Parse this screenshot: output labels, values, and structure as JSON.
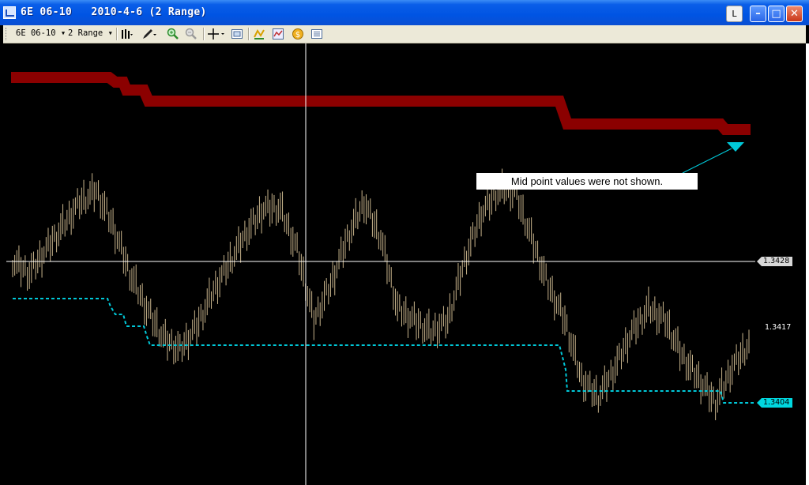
{
  "window": {
    "title": "6E 06-10   2010-4-6 (2 Range)",
    "buttons": {
      "l_label": "L",
      "min_label": "–",
      "max_label": "□",
      "close_label": "✕"
    }
  },
  "toolbar": {
    "instrument_label": "6E 06-10 ▾",
    "interval_label": "2 Range ▾",
    "icons": [
      "bar-style-icon",
      "drawing-pencil-icon",
      "zoom-in-icon",
      "zoom-out-icon",
      "crosshair-icon",
      "properties-icon",
      "indicators-icon",
      "strategy-icon",
      "coin-icon",
      "data-box-icon"
    ]
  },
  "chart": {
    "background": "#000000",
    "bar_color": "#c8b48c",
    "upper_band_color": "#8b0000",
    "stop_line_color": "#00c8d8",
    "crosshair_color": "#ffffff",
    "current_price_label": "1.3428",
    "last_price_label": "1.3417",
    "stop_price_label": "1.3404",
    "annotation": "Mid point values were not shown.",
    "annotation_arrow_color": "#00c8d8"
  },
  "chart_data": {
    "type": "line",
    "title": "",
    "price_labels": [
      1.3428,
      1.3417,
      1.3404
    ],
    "bars_approx_closes": [
      1.3428,
      1.3426,
      1.343,
      1.3434,
      1.3438,
      1.344,
      1.3434,
      1.3426,
      1.342,
      1.3415,
      1.3413,
      1.3417,
      1.3423,
      1.3428,
      1.3433,
      1.3437,
      1.3437,
      1.343,
      1.3418,
      1.3424,
      1.3432,
      1.3438,
      1.3432,
      1.342,
      1.3418,
      1.3416,
      1.3418,
      1.3428,
      1.3436,
      1.344,
      1.344,
      1.3432,
      1.3424,
      1.3418,
      1.3408,
      1.3405,
      1.341,
      1.3416,
      1.342,
      1.3418,
      1.3412,
      1.3408,
      1.3404,
      1.341,
      1.3414
    ]
  }
}
